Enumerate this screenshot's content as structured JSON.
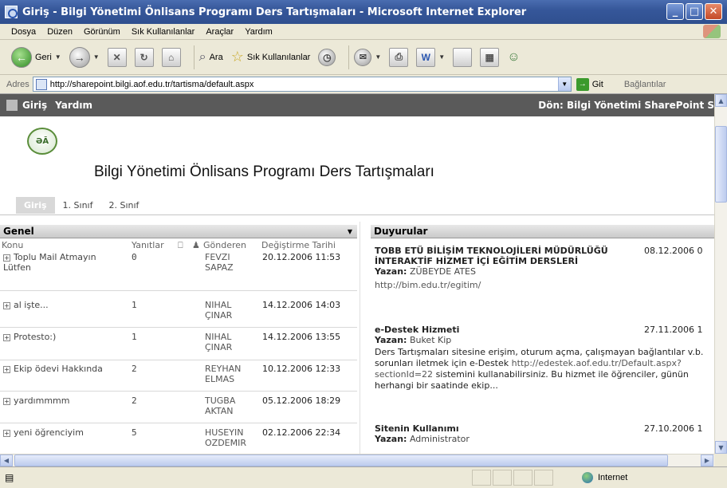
{
  "window": {
    "title": "Giriş - Bilgi Yönetimi Önlisans Programı Ders Tartışmaları - Microsoft Internet Explorer"
  },
  "menu": [
    "Dosya",
    "Düzen",
    "Görünüm",
    "Sık Kullanılanlar",
    "Araçlar",
    "Yardım"
  ],
  "toolbar": {
    "back": "Geri",
    "search": "Ara",
    "favorites": "Sık Kullanılanlar"
  },
  "address": {
    "label": "Adres",
    "url": "http://sharepoint.bilgi.aof.edu.tr/tartisma/default.aspx",
    "go": "Git",
    "links": "Bağlantılar"
  },
  "status": {
    "zone": "Internet"
  },
  "sp": {
    "nav_home": "Giriş",
    "nav_help": "Yardım",
    "return_link": "Dön: Bilgi Yönetimi SharePoint S",
    "site_title": "Bilgi Yönetimi Önlisans Programı Ders Tartışmaları",
    "tabs": [
      "Giriş",
      "1. Sınıf",
      "2. Sınıf"
    ]
  },
  "general": {
    "heading": "Genel",
    "columns": {
      "topic": "Konu",
      "replies": "Yanıtlar",
      "sender": "Gönderen",
      "modified": "Değiştirme Tarihi"
    },
    "rows": [
      {
        "topic": "Toplu Mail Atmayın Lütfen",
        "replies": "0",
        "sender": "FEVZI SAPAZ",
        "date": "20.12.2006 11:53"
      },
      {
        "topic": "al işte...",
        "replies": "1",
        "sender": "NIHAL ÇINAR",
        "date": "14.12.2006 14:03"
      },
      {
        "topic": "Protesto:)",
        "replies": "1",
        "sender": "NIHAL ÇINAR",
        "date": "14.12.2006 13:55"
      },
      {
        "topic": "Ekip ödevi Hakkında",
        "replies": "2",
        "sender": "REYHAN ELMAS",
        "date": "10.12.2006 12:33"
      },
      {
        "topic": "yardımmmm",
        "replies": "2",
        "sender": "TUGBA AKTAN",
        "date": "05.12.2006 18:29"
      },
      {
        "topic": "yeni öğrenciyim",
        "replies": "5",
        "sender": "HUSEYIN OZDEMIR",
        "date": "02.12.2006 22:34"
      }
    ]
  },
  "announcements": {
    "heading": "Duyurular",
    "author_label": "Yazan:",
    "items": [
      {
        "title": "TOBB ETÜ BİLİŞİM TEKNOLOJİLERİ MÜDÜRLÜĞÜ İNTERAKTİF HİZMET İÇİ EĞİTİM DERSLERİ",
        "date": "08.12.2006 0",
        "author": "ZÜBEYDE ATES",
        "link": "http://bim.edu.tr/egitim/"
      },
      {
        "title": "e-Destek Hizmeti",
        "date": "27.11.2006 1",
        "author": "Buket Kip",
        "body_before": "Ders Tartışmaları sitesine erişim, oturum açma, çalışmayan bağlantılar v.b. sorunları iletmek için e-Destek",
        "link": "http://edestek.aof.edu.tr/Default.aspx?sectionId=22",
        "body_after": "sistemini kullanabilirsiniz. Bu hizmet ile öğrenciler, günün herhangi bir saatinde ekip..."
      },
      {
        "title": "Sitenin Kullanımı",
        "date": "27.10.2006 1",
        "author": "Administrator"
      }
    ]
  }
}
